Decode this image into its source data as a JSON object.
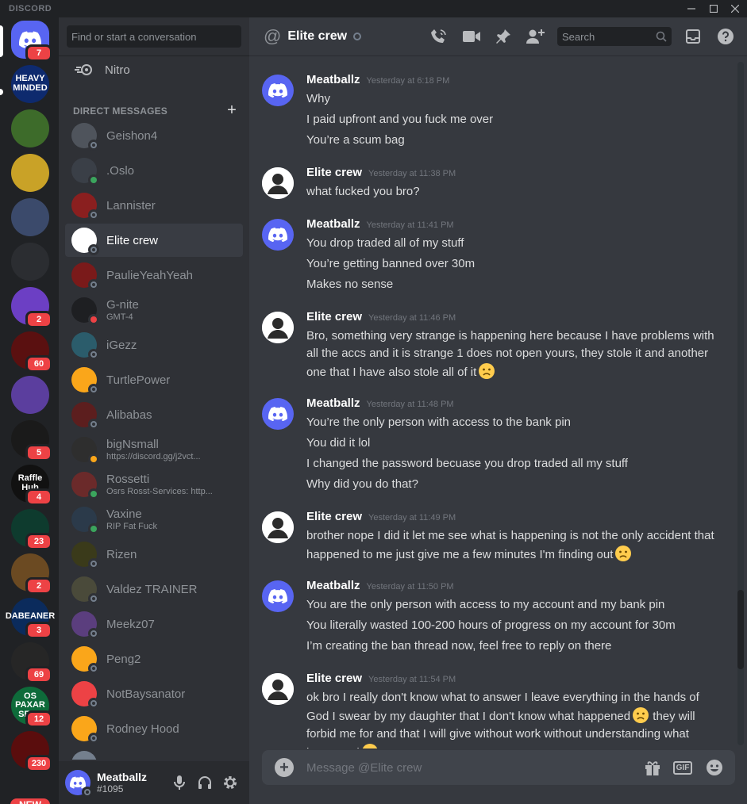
{
  "app": {
    "wordmark": "DISCORD"
  },
  "servers": [
    {
      "label": "",
      "badge": "7",
      "color": "#5865f2",
      "type": "home"
    },
    {
      "label": "HEAVY MINDED",
      "badge": "",
      "color": "#0e2a6e"
    },
    {
      "label": "",
      "badge": "",
      "color": "#3d6b2a"
    },
    {
      "label": "",
      "badge": "",
      "color": "#c9a227"
    },
    {
      "label": "",
      "badge": "",
      "color": "#3b4a6b"
    },
    {
      "label": "",
      "badge": "",
      "color": "#2b2d31"
    },
    {
      "label": "",
      "badge": "2",
      "color": "#6c3fc4"
    },
    {
      "label": "",
      "badge": "60",
      "color": "#5a1010"
    },
    {
      "label": "",
      "badge": "",
      "color": "#5b3e9e"
    },
    {
      "label": "",
      "badge": "5",
      "color": "#1a1a1a"
    },
    {
      "label": "Raffle Hub",
      "badge": "4",
      "color": "#111111"
    },
    {
      "label": "",
      "badge": "23",
      "color": "#0e3b2e"
    },
    {
      "label": "",
      "badge": "2",
      "color": "#6b4a22"
    },
    {
      "label": "DABEANER",
      "badge": "3",
      "color": "#0b2b5c"
    },
    {
      "label": "",
      "badge": "69",
      "color": "#262626"
    },
    {
      "label": "OS PAXAR SERV",
      "badge": "12",
      "color": "#0e6b3a"
    },
    {
      "label": "",
      "badge": "230",
      "color": "#5a0d0d"
    }
  ],
  "new_badge": "NEW",
  "sidebar": {
    "search_placeholder": "Find or start a conversation",
    "nitro_label": "Nitro",
    "dm_header": "DIRECT MESSAGES",
    "dm_add": "+",
    "dms": [
      {
        "name": "Geishon4",
        "sub": "",
        "status": "offline",
        "color": "#4f545c"
      },
      {
        "name": ".Oslo",
        "sub": "",
        "status": "online",
        "color": "#3a3f47"
      },
      {
        "name": "Lannister",
        "sub": "",
        "status": "offline",
        "color": "#8a1f1f"
      },
      {
        "name": "Elite crew",
        "sub": "",
        "status": "offline",
        "color": "#ffffff",
        "active": true
      },
      {
        "name": "PaulieYeahYeah",
        "sub": "",
        "status": "offline",
        "color": "#7a1a1a"
      },
      {
        "name": "G-nite",
        "sub": "GMT-4",
        "status": "dnd",
        "color": "#1e1f22"
      },
      {
        "name": "iGezz",
        "sub": "",
        "status": "offline",
        "color": "#2b5c6b"
      },
      {
        "name": "TurtlePower",
        "sub": "",
        "status": "offline",
        "color": "#faa61a"
      },
      {
        "name": "Alibabas",
        "sub": "",
        "status": "offline",
        "color": "#5c1e1e"
      },
      {
        "name": "bigNsmall",
        "sub": "https://discord.gg/j2vct...",
        "status": "idle",
        "color": "#2e2e2e"
      },
      {
        "name": "Rossetti",
        "sub": "Osrs Rosst-Services: http...",
        "status": "online",
        "color": "#6b2a2a"
      },
      {
        "name": "Vaxine",
        "sub": "RIP Fat Fuck",
        "status": "online",
        "color": "#2b3a4a"
      },
      {
        "name": "Rizen",
        "sub": "",
        "status": "offline",
        "color": "#3a3a1a"
      },
      {
        "name": "Valdez TRAINER",
        "sub": "",
        "status": "offline",
        "color": "#4a4a3a"
      },
      {
        "name": "Meekz07",
        "sub": "",
        "status": "offline",
        "color": "#5b3e7e"
      },
      {
        "name": "Peng2",
        "sub": "",
        "status": "offline",
        "color": "#faa61a"
      },
      {
        "name": "NotBaysanator",
        "sub": "",
        "status": "offline",
        "color": "#ed4245"
      },
      {
        "name": "Rodney Hood",
        "sub": "",
        "status": "offline",
        "color": "#faa61a"
      },
      {
        "name": "",
        "sub": "",
        "status": "offline",
        "color": "#747f8d"
      }
    ]
  },
  "user_panel": {
    "name": "Meatballz",
    "tag": "#1095"
  },
  "chat": {
    "title": "Elite crew",
    "search_placeholder": "Search",
    "composer_placeholder": "Message @Elite crew",
    "gif_label": "GIF",
    "groups": [
      {
        "author": "Meatballz",
        "time": "Yesterday at 6:18 PM",
        "avatar": "mb",
        "lines": [
          {
            "text": "Why"
          },
          {
            "text": "I paid upfront and you fuck me over"
          },
          {
            "text": "You’re a scum bag"
          }
        ]
      },
      {
        "author": "Elite crew",
        "time": "Yesterday at 11:38 PM",
        "avatar": "ec",
        "lines": [
          {
            "text": "what fucked you bro?"
          }
        ]
      },
      {
        "author": "Meatballz",
        "time": "Yesterday at 11:41 PM",
        "avatar": "mb",
        "lines": [
          {
            "text": "You drop traded all of my stuff"
          },
          {
            "text": "You’re getting banned over 30m"
          },
          {
            "text": "Makes no sense"
          }
        ]
      },
      {
        "author": "Elite crew",
        "time": "Yesterday at 11:46 PM",
        "avatar": "ec",
        "lines": [
          {
            "text": "Bro, something very strange is happening here because I have problems with all the accs and it is strange 1 does not open yours, they stole it and another one that I have also stole all of it",
            "emoji": true
          }
        ]
      },
      {
        "author": "Meatballz",
        "time": "Yesterday at 11:48 PM",
        "avatar": "mb",
        "lines": [
          {
            "text": "You’re the only person with access to the bank pin"
          },
          {
            "text": "You did it lol"
          },
          {
            "text": "I changed the password becuase you drop traded all my stuff"
          },
          {
            "text": "Why did you do that?"
          }
        ]
      },
      {
        "author": "Elite crew",
        "time": "Yesterday at 11:49 PM",
        "avatar": "ec",
        "lines": [
          {
            "text": "brother nope I did it let me see what is happening is not the only accident that happened to me just give me a few minutes I'm finding out",
            "emoji": true
          }
        ]
      },
      {
        "author": "Meatballz",
        "time": "Yesterday at 11:50 PM",
        "avatar": "mb",
        "lines": [
          {
            "text": "You are the only person with access to my account and my bank pin"
          },
          {
            "text": "You literally wasted 100-200 hours of progress on my account for 30m"
          },
          {
            "text": "I’m creating the ban thread now, feel free to reply on there"
          }
        ]
      },
      {
        "author": "Elite crew",
        "time": "Yesterday at 11:54 PM",
        "avatar": "ec",
        "lines": [
          {
            "text": "ok bro I really don't know what to answer I leave everything in the hands of God I swear by my daughter that I don't know what happened",
            "emoji_mid": true,
            "text2": " they will forbid me for and that I will give without work without understanding what happened",
            "emoji": true
          }
        ]
      }
    ]
  }
}
